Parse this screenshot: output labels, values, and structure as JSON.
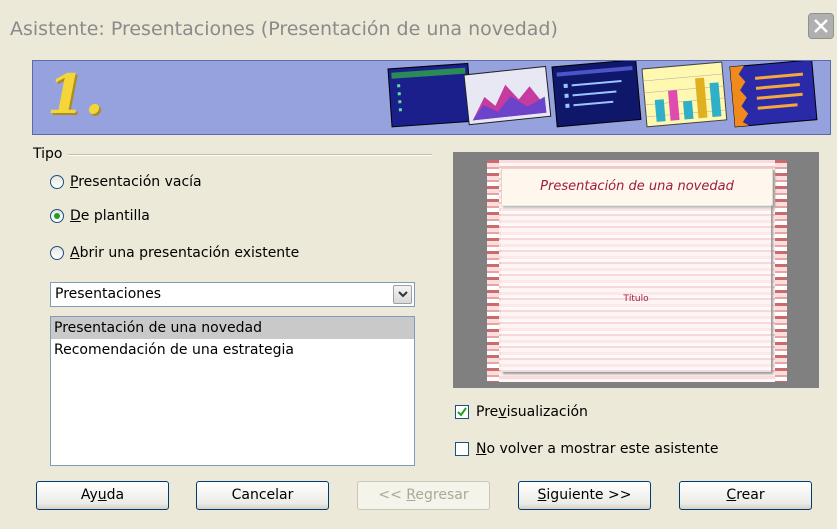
{
  "window": {
    "title": "Asistente: Presentaciones (Presentación de una novedad)"
  },
  "banner": {
    "step_number": "1."
  },
  "tipo": {
    "label": "Tipo",
    "options": [
      {
        "pre": "",
        "mnemonic": "P",
        "post": "resentación vacía",
        "checked": false
      },
      {
        "pre": "",
        "mnemonic": "D",
        "post": "e plantilla",
        "checked": true
      },
      {
        "pre": "",
        "mnemonic": "A",
        "post": "brir una presentación existente",
        "checked": false
      }
    ]
  },
  "category_select": {
    "value": "Presentaciones"
  },
  "template_list": {
    "items": [
      "Presentación de una novedad",
      "Recomendación de una estrategia"
    ],
    "selected_index": 0
  },
  "preview": {
    "slide_title": "Presentación de una novedad",
    "slide_subtitle": "Título"
  },
  "options": {
    "preview_check": {
      "pre": "Pre",
      "mnemonic": "v",
      "post": "isualización",
      "checked": true
    },
    "no_show_check": {
      "pre": "",
      "mnemonic": "N",
      "post": "o volver a mostrar este asistente",
      "checked": false
    }
  },
  "buttons": {
    "help": {
      "pre": "Ay",
      "mnemonic": "u",
      "post": "da"
    },
    "cancel": {
      "label": "Cancelar"
    },
    "back": {
      "pre": "<< ",
      "mnemonic": "R",
      "post": "egresar"
    },
    "next": {
      "pre": "",
      "mnemonic": "S",
      "post": "iguiente >>"
    },
    "create": {
      "pre": "",
      "mnemonic": "C",
      "post": "rear"
    }
  },
  "colors": {
    "banner_bg": "#96a2de",
    "step_number": "#f4d63a",
    "slide_title_text": "#a01c3a",
    "selection_bg": "#c9c9c9"
  }
}
